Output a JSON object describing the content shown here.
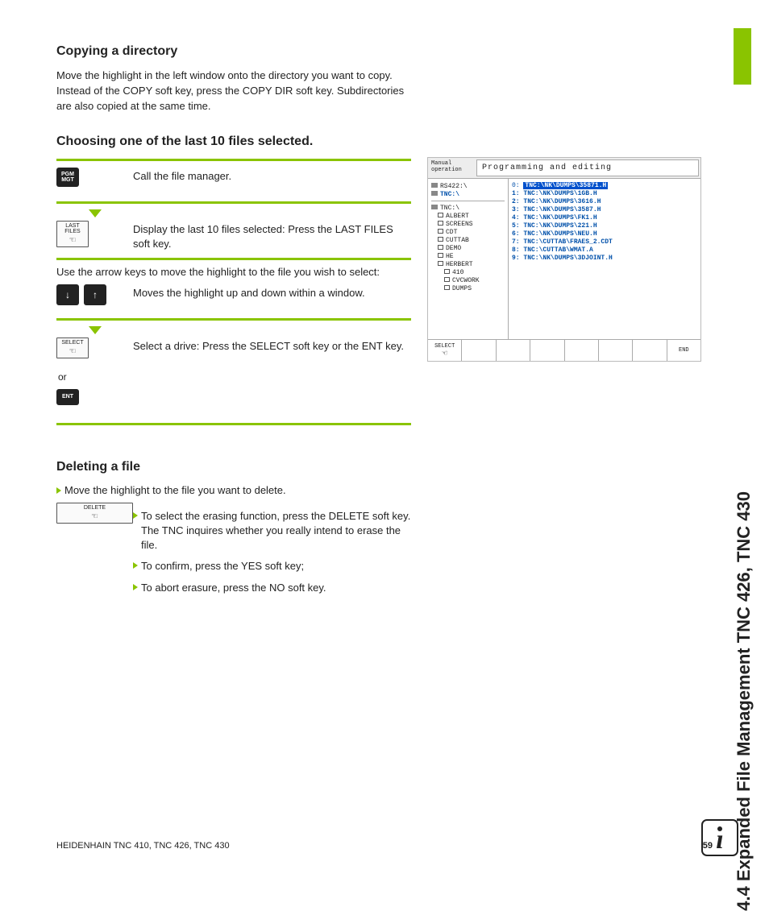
{
  "sideTitle": "4.4 Expanded File Management TNC 426, TNC 430",
  "sections": {
    "copyDir": {
      "heading": "Copying a directory",
      "body": "Move the highlight in the left window onto the directory you want to copy. Instead of the COPY soft key, press the COPY DIR soft key. Subdirectories are also copied at the same time."
    },
    "last10": {
      "heading": "Choosing one of the last 10 files selected."
    },
    "delete": {
      "heading": "Deleting a file",
      "intro": "Move the highlight to the file you want to delete.",
      "items": [
        "To select the erasing function, press the DELETE soft key. The TNC inquires whether you really intend to erase the file.",
        "To confirm, press the YES soft key;",
        "To abort erasure, press the NO soft key."
      ]
    }
  },
  "steps": {
    "pgmmgt": {
      "label1": "PGM",
      "label2": "MGT",
      "text": "Call the file manager."
    },
    "lastfiles": {
      "label1": "LAST",
      "label2": "FILES",
      "text": "Display the last 10 files selected: Press the LAST FILES soft key."
    },
    "arrows": {
      "intro": "Use the arrow keys to move the highlight to the file you wish to select:",
      "text": "Moves the highlight up and down within a window."
    },
    "select": {
      "label": "SELECT",
      "text": "Select a drive: Press the SELECT soft key or the ENT key."
    },
    "or": "or",
    "ent": "ENT",
    "delete": {
      "label": "DELETE"
    }
  },
  "figure": {
    "mode": "Manual\noperation",
    "title": "Programming and editing",
    "drives": [
      "RS422:\\",
      "TNC:\\"
    ],
    "treeRoot": "TNC:\\",
    "tree": [
      "ALBERT",
      "SCREENS",
      "CDT",
      "CUTTAB",
      "DEMO",
      "HE",
      "HERBERT",
      "410",
      "CVCWORK",
      "DUMPS"
    ],
    "files": [
      {
        "n": "0",
        "name": "TNC:\\NK\\DUMPS\\35871.H",
        "sel": true
      },
      {
        "n": "1",
        "name": "TNC:\\NK\\DUMPS\\1GB.H"
      },
      {
        "n": "2",
        "name": "TNC:\\NK\\DUMPS\\3616.H"
      },
      {
        "n": "3",
        "name": "TNC:\\NK\\DUMPS\\3587.H"
      },
      {
        "n": "4",
        "name": "TNC:\\NK\\DUMPS\\FK1.H"
      },
      {
        "n": "5",
        "name": "TNC:\\NK\\DUMPS\\221.H"
      },
      {
        "n": "6",
        "name": "TNC:\\NK\\DUMPS\\NEU.H"
      },
      {
        "n": "7",
        "name": "TNC:\\CUTTAB\\FRAES_2.CDT"
      },
      {
        "n": "8",
        "name": "TNC:\\CUTTAB\\WMAT.A"
      },
      {
        "n": "9",
        "name": "TNC:\\NK\\DUMPS\\3DJOINT.H"
      }
    ],
    "sk": {
      "select": "SELECT",
      "end": "END"
    }
  },
  "footer": {
    "left": "HEIDENHAIN TNC 410, TNC 426, TNC 430",
    "page": "59"
  }
}
